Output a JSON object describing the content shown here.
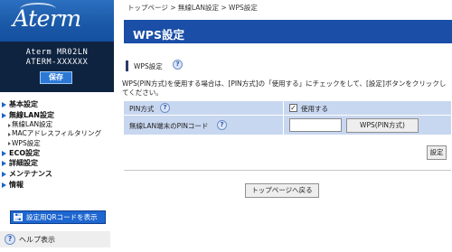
{
  "brand": {
    "logo": "Aterm"
  },
  "device": {
    "model": "Aterm MR02LN",
    "ssid": "ATERM-XXXXXX"
  },
  "sidebar": {
    "save_label": "保存",
    "nav": [
      {
        "label": "基本設定"
      },
      {
        "label": "無線LAN設定"
      },
      {
        "label": "無線LAN設定",
        "sub": true
      },
      {
        "label": "MACアドレスフィルタリング",
        "sub": true
      },
      {
        "label": "WPS設定",
        "sub": true
      },
      {
        "label": "ECO設定"
      },
      {
        "label": "詳細設定"
      },
      {
        "label": "メンテナンス"
      },
      {
        "label": "情報"
      }
    ],
    "qr_button": "設定用QRコードを表示",
    "qr_icon": "qr-code-icon",
    "help_label": "ヘルプ表示"
  },
  "breadcrumb": "トップページ > 無線LAN設定 > WPS設定",
  "page_title": "WPS設定",
  "section_title": "WPS設定",
  "help_glyph": "?",
  "description": "WPS(PIN方式)を使用する場合は、[PIN方式]の「使用する」にチェックをして、[設定]ボタンをクリックしてください。",
  "form": {
    "pin_method_label": "PIN方式",
    "pin_method_checked": true,
    "pin_method_option": "使用する",
    "pin_code_label": "無線LAN端末のPINコード",
    "pin_code_value": "",
    "wps_pin_button": "WPS(PIN方式)"
  },
  "settings_button": "設定",
  "back_to_top_button": "トップページへ戻る",
  "colors": {
    "header": "#1a4ea7",
    "sidebar_dark": "#0e2340",
    "accent": "#1e66d0",
    "table_row": "#c8d7f0"
  }
}
